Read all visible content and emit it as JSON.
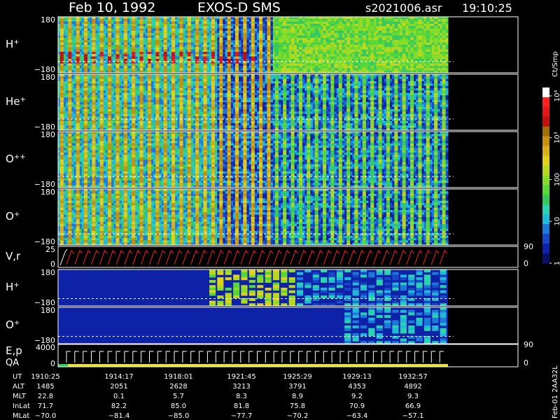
{
  "header": {
    "date": "Feb 10, 1992",
    "mission": "EXOS-D SMS",
    "file": "s2021006.asr",
    "time": "19:10:25"
  },
  "colorbar": {
    "label": "Ct/Smp",
    "ticks": [
      {
        "label": "1",
        "v": 1
      },
      {
        "label": "10",
        "v": 10
      },
      {
        "label": "100",
        "v": 100
      },
      {
        "label": "10³",
        "v": 1000
      },
      {
        "label": "10⁴",
        "v": 10000
      }
    ],
    "colors": [
      "#0a1064",
      "#0e22a8",
      "#1846c8",
      "#1e78d8",
      "#22b8d8",
      "#2ad2b0",
      "#38c860",
      "#58d838",
      "#86dc28",
      "#b8d820",
      "#e0d020",
      "#d8b018",
      "#c89010",
      "#a07008",
      "#c01010",
      "#e01818",
      "#ff2020",
      "#ffffff"
    ]
  },
  "panels": [
    {
      "label": "H",
      "sup": "+",
      "ymax": "180",
      "ymin": "−180",
      "kind": "spin",
      "seed": 1,
      "red": true
    },
    {
      "label": "He",
      "sup": "+",
      "ymax": "180",
      "ymin": "−180",
      "kind": "spin",
      "seed": 2
    },
    {
      "label": "O",
      "sup": "++",
      "ymax": "180",
      "ymin": "−180",
      "kind": "spin",
      "seed": 3
    },
    {
      "label": "O",
      "sup": "+",
      "ymax": "180",
      "ymin": "−180",
      "kind": "spin",
      "seed": 4
    },
    {
      "label": "V,r",
      "ymax": "25",
      "ymin": "0",
      "right_top": "90",
      "right_bottom": "0",
      "kind": "vr"
    },
    {
      "label": "H",
      "sup": "+",
      "ymax": "180",
      "ymin": "−180",
      "kind": "h2",
      "seed": 5
    },
    {
      "label": "O",
      "sup": "+",
      "ymax": "180",
      "ymin": "−180",
      "kind": "o2",
      "seed": 6
    },
    {
      "label": "E,p",
      "label2": "QA",
      "ymax": "4000",
      "ymin": "0",
      "right_top": "90",
      "right_bottom": "0",
      "kind": "ep"
    }
  ],
  "footer": {
    "row_labels": [
      "UT",
      "ALT",
      "MLT",
      "InLat",
      "MLat"
    ],
    "columns": [
      [
        "1910:25",
        "1485",
        "22.8",
        "71.7",
        "−70.0"
      ],
      [
        "1914:17",
        "2051",
        "0.1",
        "82.2",
        "−81.4"
      ],
      [
        "1918:01",
        "2628",
        "5.7",
        "85.0",
        "−85.0"
      ],
      [
        "1921:45",
        "3213",
        "8.3",
        "81.8",
        "−77.7"
      ],
      [
        "1925:29",
        "3791",
        "8.9",
        "75.8",
        "−70.2"
      ],
      [
        "1929:13",
        "4353",
        "9.2",
        "70.9",
        "−63.4"
      ],
      [
        "1932:57",
        "4892",
        "9.3",
        "66.9",
        "−57.1"
      ]
    ],
    "id_text": "Feb-01 2AA32L"
  }
}
